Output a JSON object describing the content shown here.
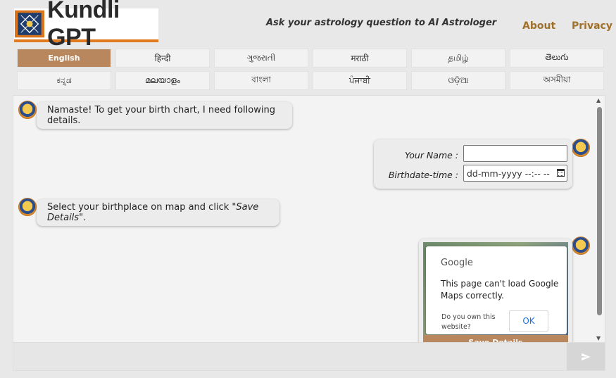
{
  "header": {
    "logo_text": "Kundli GPT",
    "tagline": "Ask your astrology question to AI Astrologer",
    "nav": [
      {
        "label": "About"
      },
      {
        "label": "Privacy"
      }
    ]
  },
  "languages": [
    {
      "label": "English",
      "active": true
    },
    {
      "label": "हिन्दी"
    },
    {
      "label": "ગુજરાતી"
    },
    {
      "label": "मराठी"
    },
    {
      "label": "தமிழ்"
    },
    {
      "label": "తెలుగు"
    },
    {
      "label": "ಕನ್ನಡ"
    },
    {
      "label": "മലയാളം"
    },
    {
      "label": "বাংলা"
    },
    {
      "label": "ਪੰਜਾਬੀ"
    },
    {
      "label": "ଓଡ଼ିଆ"
    },
    {
      "label": "অসমীয়া"
    }
  ],
  "chat": {
    "msg1": "Namaste! To get your birth chart, I need following details.",
    "form": {
      "name_label": "Your Name :",
      "name_value": "",
      "birth_label": "Birthdate-time :",
      "birth_placeholder": "dd-mm-yyyy --:-- --"
    },
    "msg2_prefix": "Select your birthplace on map and click ",
    "msg2_emph": "\"Save Details\"",
    "msg2_suffix": ".",
    "map_dialog": {
      "title": "Google",
      "message": "This page can't load Google Maps correctly.",
      "own_question": "Do you own this website?",
      "ok_label": "OK"
    },
    "save_label": "Save Details"
  },
  "input_bar": {
    "placeholder": "",
    "send_icon": "send-icon"
  },
  "colors": {
    "accent": "#b8875d",
    "nav": "#a0702a",
    "logo_orange": "#e07b1f"
  }
}
